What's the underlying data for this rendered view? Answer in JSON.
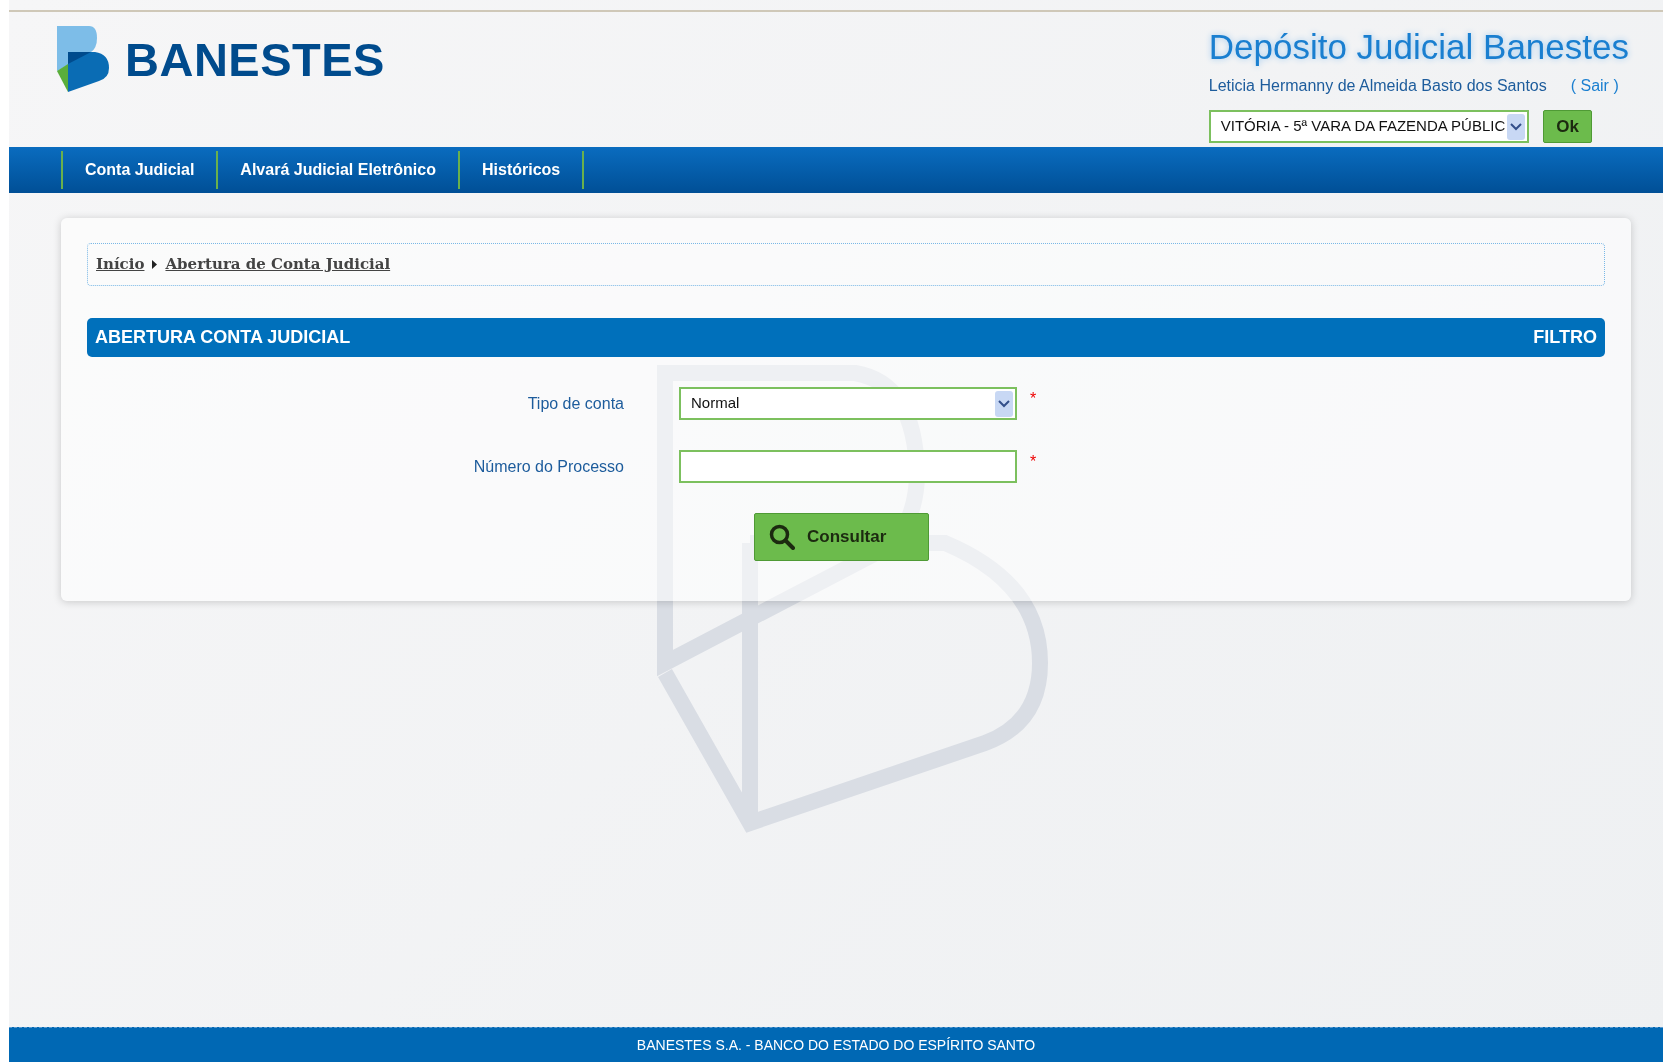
{
  "header": {
    "logo": "BANESTES",
    "title": "Depósito Judicial Banestes",
    "user": "Leticia Hermanny de Almeida Basto dos Santos",
    "logout": "( Sair )",
    "unit_select": {
      "value": "VITÓRIA - 5ª VARA DA FAZENDA PÚBLIC"
    },
    "ok_button": "Ok"
  },
  "nav": [
    {
      "label": "Conta Judicial"
    },
    {
      "label": "Alvará Judicial Eletrônico"
    },
    {
      "label": "Históricos"
    }
  ],
  "breadcrumb": [
    {
      "label": "Início"
    },
    {
      "label": "Abertura de Conta Judicial"
    }
  ],
  "panel": {
    "title": "ABERTURA CONTA JUDICIAL",
    "filter": "FILTRO"
  },
  "fields": [
    {
      "kind": "select",
      "label": "Tipo de conta",
      "value": "Normal",
      "required_mark": "*"
    },
    {
      "kind": "text",
      "label": "Número do Processo",
      "required_mark": "*"
    }
  ],
  "submit": "Consultar",
  "footer": "BANESTES S.A. - BANCO DO ESTADO DO ESPÍRITO SANTO"
}
